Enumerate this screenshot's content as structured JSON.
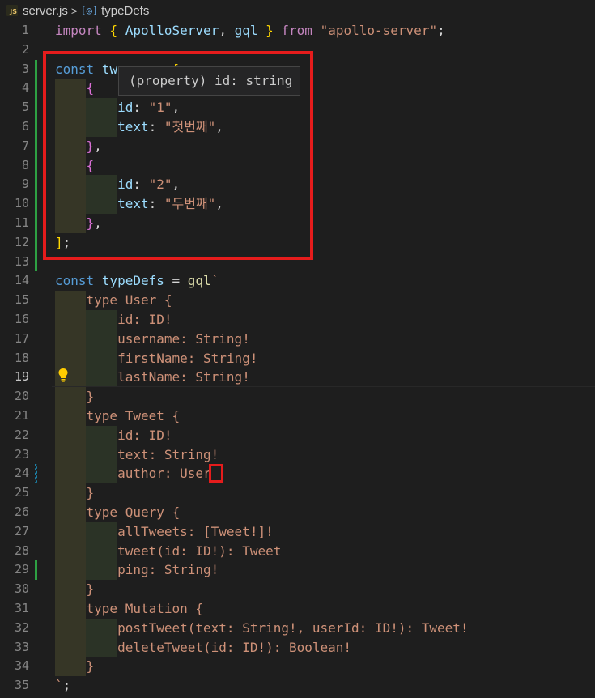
{
  "breadcrumb": {
    "file_icon": "JS",
    "file": "server.js",
    "separator": ">",
    "symbol_icon": "symbol-variable-icon",
    "symbol": "typeDefs"
  },
  "hover": {
    "text": "(property) id: string"
  },
  "colors": {
    "keyword": "#569cd6",
    "variable": "#9cdcfe",
    "string": "#ce9178",
    "highlight": "#e51c1c"
  },
  "lines": [
    {
      "n": "1",
      "segs": [
        [
          "import",
          "import"
        ],
        [
          "plain",
          " "
        ],
        [
          "brace",
          "{"
        ],
        [
          "plain",
          " "
        ],
        [
          "var",
          "ApolloServer"
        ],
        [
          "plain",
          ", "
        ],
        [
          "var",
          "gql"
        ],
        [
          "plain",
          " "
        ],
        [
          "brace",
          "}"
        ],
        [
          "plain",
          " "
        ],
        [
          "import",
          "from"
        ],
        [
          "plain",
          " "
        ],
        [
          "str",
          "\"apollo-server\""
        ],
        [
          "plain",
          ";"
        ]
      ]
    },
    {
      "n": "2",
      "segs": []
    },
    {
      "n": "3",
      "segs": [
        [
          "kw",
          "const"
        ],
        [
          "plain",
          " "
        ],
        [
          "var",
          "tw"
        ],
        [
          "plain",
          "       "
        ],
        [
          "brace",
          "["
        ]
      ]
    },
    {
      "n": "4",
      "segs": [
        [
          "plain",
          "    "
        ],
        [
          "brace2",
          "{"
        ]
      ]
    },
    {
      "n": "5",
      "segs": [
        [
          "plain",
          "        "
        ],
        [
          "var",
          "id"
        ],
        [
          "plain",
          ": "
        ],
        [
          "str",
          "\"1\""
        ],
        [
          "plain",
          ","
        ]
      ]
    },
    {
      "n": "6",
      "segs": [
        [
          "plain",
          "        "
        ],
        [
          "var",
          "text"
        ],
        [
          "plain",
          ": "
        ],
        [
          "str",
          "\"첫번째\""
        ],
        [
          "plain",
          ","
        ]
      ]
    },
    {
      "n": "7",
      "segs": [
        [
          "plain",
          "    "
        ],
        [
          "brace2",
          "}"
        ],
        [
          "plain",
          ","
        ]
      ]
    },
    {
      "n": "8",
      "segs": [
        [
          "plain",
          "    "
        ],
        [
          "brace2",
          "{"
        ]
      ]
    },
    {
      "n": "9",
      "segs": [
        [
          "plain",
          "        "
        ],
        [
          "var",
          "id"
        ],
        [
          "plain",
          ": "
        ],
        [
          "str",
          "\"2\""
        ],
        [
          "plain",
          ","
        ]
      ]
    },
    {
      "n": "10",
      "segs": [
        [
          "plain",
          "        "
        ],
        [
          "var",
          "text"
        ],
        [
          "plain",
          ": "
        ],
        [
          "str",
          "\"두번째\""
        ],
        [
          "plain",
          ","
        ]
      ]
    },
    {
      "n": "11",
      "segs": [
        [
          "plain",
          "    "
        ],
        [
          "brace2",
          "}"
        ],
        [
          "plain",
          ","
        ]
      ]
    },
    {
      "n": "12",
      "segs": [
        [
          "brace",
          "]"
        ],
        [
          "plain",
          ";"
        ]
      ]
    },
    {
      "n": "13",
      "segs": []
    },
    {
      "n": "14",
      "segs": [
        [
          "kw",
          "const"
        ],
        [
          "plain",
          " "
        ],
        [
          "var",
          "typeDefs"
        ],
        [
          "plain",
          " = "
        ],
        [
          "fn",
          "gql"
        ],
        [
          "str",
          "`"
        ]
      ]
    },
    {
      "n": "15",
      "segs": [
        [
          "gql",
          "    type User {"
        ]
      ]
    },
    {
      "n": "16",
      "segs": [
        [
          "gql",
          "        id: ID!"
        ]
      ]
    },
    {
      "n": "17",
      "segs": [
        [
          "gql",
          "        username: String!"
        ]
      ]
    },
    {
      "n": "18",
      "segs": [
        [
          "gql",
          "        firstName: String!"
        ]
      ]
    },
    {
      "n": "19",
      "segs": [
        [
          "gql",
          "        lastName: String!"
        ]
      ]
    },
    {
      "n": "20",
      "segs": [
        [
          "gql",
          "    }"
        ]
      ]
    },
    {
      "n": "21",
      "segs": [
        [
          "gql",
          "    type Tweet {"
        ]
      ]
    },
    {
      "n": "22",
      "segs": [
        [
          "gql",
          "        id: ID!"
        ]
      ]
    },
    {
      "n": "23",
      "segs": [
        [
          "gql",
          "        text: String!"
        ]
      ]
    },
    {
      "n": "24",
      "segs": [
        [
          "gql",
          "        author: User"
        ]
      ]
    },
    {
      "n": "25",
      "segs": [
        [
          "gql",
          "    }"
        ]
      ]
    },
    {
      "n": "26",
      "segs": [
        [
          "gql",
          "    type Query {"
        ]
      ]
    },
    {
      "n": "27",
      "segs": [
        [
          "gql",
          "        allTweets: [Tweet!]!"
        ]
      ]
    },
    {
      "n": "28",
      "segs": [
        [
          "gql",
          "        tweet(id: ID!): Tweet"
        ]
      ]
    },
    {
      "n": "29",
      "segs": [
        [
          "gql",
          "        ping: String!"
        ]
      ]
    },
    {
      "n": "30",
      "segs": [
        [
          "gql",
          "    }"
        ]
      ]
    },
    {
      "n": "31",
      "segs": [
        [
          "gql",
          "    type Mutation {"
        ]
      ]
    },
    {
      "n": "32",
      "segs": [
        [
          "gql",
          "        postTweet(text: String!, userId: ID!): Tweet!"
        ]
      ]
    },
    {
      "n": "33",
      "segs": [
        [
          "gql",
          "        deleteTweet(id: ID!): Boolean!"
        ]
      ]
    },
    {
      "n": "34",
      "segs": [
        [
          "gql",
          "    }"
        ]
      ]
    },
    {
      "n": "35",
      "segs": [
        [
          "gql",
          "`"
        ],
        [
          "plain",
          ";"
        ]
      ]
    }
  ],
  "active_line": "19",
  "lightbulb_icon": "lightbulb-icon"
}
